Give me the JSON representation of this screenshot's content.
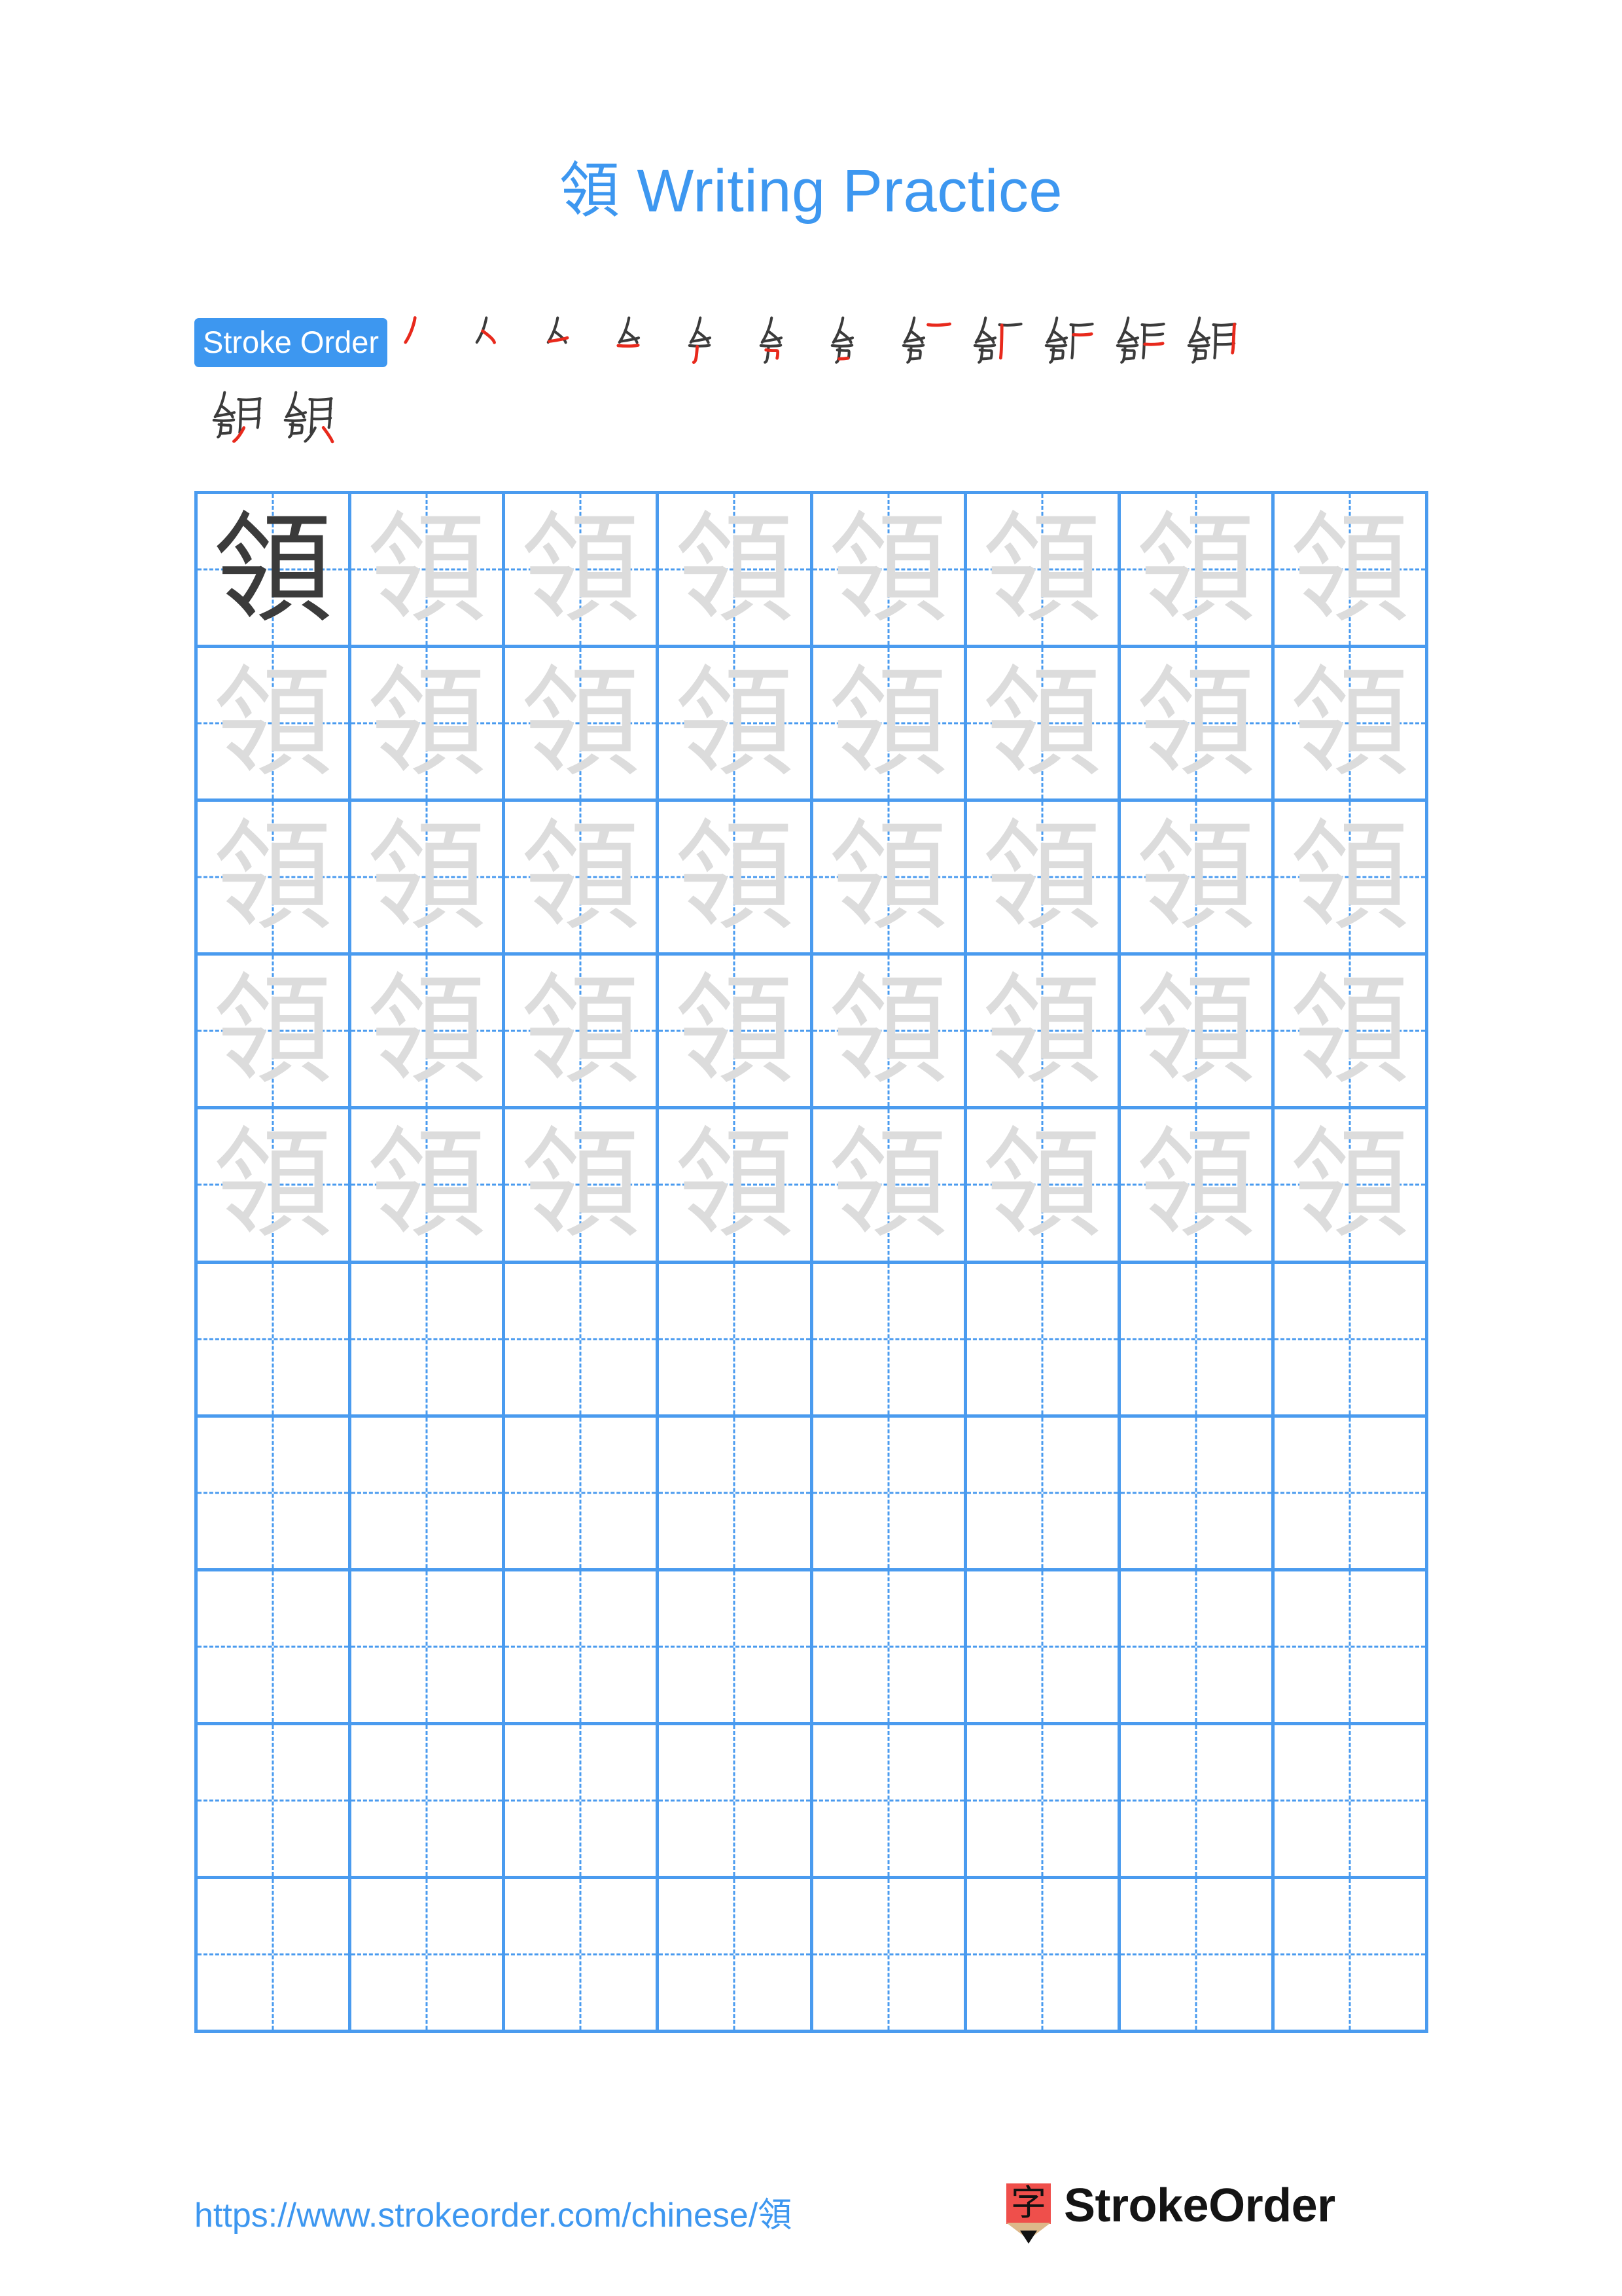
{
  "character": "領",
  "title": {
    "character": "領",
    "suffix": " Writing Practice",
    "full": "領 Writing Practice",
    "color": "#3d97f0"
  },
  "stroke_order": {
    "badge_label": "Stroke Order",
    "badge_bg": "#3d97f0",
    "badge_text_color": "#ffffff",
    "total_strokes": 14,
    "new_stroke_color": "#e8291c",
    "existing_stroke_color": "#3b3b3b",
    "row_1_count": 12,
    "row_2_count": 2,
    "steps": [
      {
        "index": 1,
        "strokes_shown": 1
      },
      {
        "index": 2,
        "strokes_shown": 2
      },
      {
        "index": 3,
        "strokes_shown": 3
      },
      {
        "index": 4,
        "strokes_shown": 4
      },
      {
        "index": 5,
        "strokes_shown": 5
      },
      {
        "index": 6,
        "strokes_shown": 6
      },
      {
        "index": 7,
        "strokes_shown": 7
      },
      {
        "index": 8,
        "strokes_shown": 8
      },
      {
        "index": 9,
        "strokes_shown": 9
      },
      {
        "index": 10,
        "strokes_shown": 10
      },
      {
        "index": 11,
        "strokes_shown": 11
      },
      {
        "index": 12,
        "strokes_shown": 12
      },
      {
        "index": 13,
        "strokes_shown": 13
      },
      {
        "index": 14,
        "strokes_shown": 14
      }
    ]
  },
  "practice_grid": {
    "columns": 8,
    "rows": 10,
    "grid_line_color": "#4a9bef",
    "guide_line_color": "#4a9bef",
    "model_char_color": "#3b3b3b",
    "trace_char_color": "#dcdcdc",
    "filled_rows": 5,
    "empty_rows": 5,
    "cells": [
      {
        "r": 1,
        "c": 1,
        "char": "領",
        "style": "dark"
      },
      {
        "r": 1,
        "c": 2,
        "char": "領",
        "style": "light"
      },
      {
        "r": 1,
        "c": 3,
        "char": "領",
        "style": "light"
      },
      {
        "r": 1,
        "c": 4,
        "char": "領",
        "style": "light"
      },
      {
        "r": 1,
        "c": 5,
        "char": "領",
        "style": "light"
      },
      {
        "r": 1,
        "c": 6,
        "char": "領",
        "style": "light"
      },
      {
        "r": 1,
        "c": 7,
        "char": "領",
        "style": "light"
      },
      {
        "r": 1,
        "c": 8,
        "char": "領",
        "style": "light"
      },
      {
        "r": 2,
        "c": 1,
        "char": "領",
        "style": "light"
      },
      {
        "r": 2,
        "c": 2,
        "char": "領",
        "style": "light"
      },
      {
        "r": 2,
        "c": 3,
        "char": "領",
        "style": "light"
      },
      {
        "r": 2,
        "c": 4,
        "char": "領",
        "style": "light"
      },
      {
        "r": 2,
        "c": 5,
        "char": "領",
        "style": "light"
      },
      {
        "r": 2,
        "c": 6,
        "char": "領",
        "style": "light"
      },
      {
        "r": 2,
        "c": 7,
        "char": "領",
        "style": "light"
      },
      {
        "r": 2,
        "c": 8,
        "char": "領",
        "style": "light"
      },
      {
        "r": 3,
        "c": 1,
        "char": "領",
        "style": "light"
      },
      {
        "r": 3,
        "c": 2,
        "char": "領",
        "style": "light"
      },
      {
        "r": 3,
        "c": 3,
        "char": "領",
        "style": "light"
      },
      {
        "r": 3,
        "c": 4,
        "char": "領",
        "style": "light"
      },
      {
        "r": 3,
        "c": 5,
        "char": "領",
        "style": "light"
      },
      {
        "r": 3,
        "c": 6,
        "char": "領",
        "style": "light"
      },
      {
        "r": 3,
        "c": 7,
        "char": "領",
        "style": "light"
      },
      {
        "r": 3,
        "c": 8,
        "char": "領",
        "style": "light"
      },
      {
        "r": 4,
        "c": 1,
        "char": "領",
        "style": "light"
      },
      {
        "r": 4,
        "c": 2,
        "char": "領",
        "style": "light"
      },
      {
        "r": 4,
        "c": 3,
        "char": "領",
        "style": "light"
      },
      {
        "r": 4,
        "c": 4,
        "char": "領",
        "style": "light"
      },
      {
        "r": 4,
        "c": 5,
        "char": "領",
        "style": "light"
      },
      {
        "r": 4,
        "c": 6,
        "char": "領",
        "style": "light"
      },
      {
        "r": 4,
        "c": 7,
        "char": "領",
        "style": "light"
      },
      {
        "r": 4,
        "c": 8,
        "char": "領",
        "style": "light"
      },
      {
        "r": 5,
        "c": 1,
        "char": "領",
        "style": "light"
      },
      {
        "r": 5,
        "c": 2,
        "char": "領",
        "style": "light"
      },
      {
        "r": 5,
        "c": 3,
        "char": "領",
        "style": "light"
      },
      {
        "r": 5,
        "c": 4,
        "char": "領",
        "style": "light"
      },
      {
        "r": 5,
        "c": 5,
        "char": "領",
        "style": "light"
      },
      {
        "r": 5,
        "c": 6,
        "char": "領",
        "style": "light"
      },
      {
        "r": 5,
        "c": 7,
        "char": "領",
        "style": "light"
      },
      {
        "r": 5,
        "c": 8,
        "char": "領",
        "style": "light"
      },
      {
        "r": 6,
        "c": 1,
        "char": "",
        "style": "empty"
      },
      {
        "r": 6,
        "c": 2,
        "char": "",
        "style": "empty"
      },
      {
        "r": 6,
        "c": 3,
        "char": "",
        "style": "empty"
      },
      {
        "r": 6,
        "c": 4,
        "char": "",
        "style": "empty"
      },
      {
        "r": 6,
        "c": 5,
        "char": "",
        "style": "empty"
      },
      {
        "r": 6,
        "c": 6,
        "char": "",
        "style": "empty"
      },
      {
        "r": 6,
        "c": 7,
        "char": "",
        "style": "empty"
      },
      {
        "r": 6,
        "c": 8,
        "char": "",
        "style": "empty"
      },
      {
        "r": 7,
        "c": 1,
        "char": "",
        "style": "empty"
      },
      {
        "r": 7,
        "c": 2,
        "char": "",
        "style": "empty"
      },
      {
        "r": 7,
        "c": 3,
        "char": "",
        "style": "empty"
      },
      {
        "r": 7,
        "c": 4,
        "char": "",
        "style": "empty"
      },
      {
        "r": 7,
        "c": 5,
        "char": "",
        "style": "empty"
      },
      {
        "r": 7,
        "c": 6,
        "char": "",
        "style": "empty"
      },
      {
        "r": 7,
        "c": 7,
        "char": "",
        "style": "empty"
      },
      {
        "r": 7,
        "c": 8,
        "char": "",
        "style": "empty"
      },
      {
        "r": 8,
        "c": 1,
        "char": "",
        "style": "empty"
      },
      {
        "r": 8,
        "c": 2,
        "char": "",
        "style": "empty"
      },
      {
        "r": 8,
        "c": 3,
        "char": "",
        "style": "empty"
      },
      {
        "r": 8,
        "c": 4,
        "char": "",
        "style": "empty"
      },
      {
        "r": 8,
        "c": 5,
        "char": "",
        "style": "empty"
      },
      {
        "r": 8,
        "c": 6,
        "char": "",
        "style": "empty"
      },
      {
        "r": 8,
        "c": 7,
        "char": "",
        "style": "empty"
      },
      {
        "r": 8,
        "c": 8,
        "char": "",
        "style": "empty"
      },
      {
        "r": 9,
        "c": 1,
        "char": "",
        "style": "empty"
      },
      {
        "r": 9,
        "c": 2,
        "char": "",
        "style": "empty"
      },
      {
        "r": 9,
        "c": 3,
        "char": "",
        "style": "empty"
      },
      {
        "r": 9,
        "c": 4,
        "char": "",
        "style": "empty"
      },
      {
        "r": 9,
        "c": 5,
        "char": "",
        "style": "empty"
      },
      {
        "r": 9,
        "c": 6,
        "char": "",
        "style": "empty"
      },
      {
        "r": 9,
        "c": 7,
        "char": "",
        "style": "empty"
      },
      {
        "r": 9,
        "c": 8,
        "char": "",
        "style": "empty"
      },
      {
        "r": 10,
        "c": 1,
        "char": "",
        "style": "empty"
      },
      {
        "r": 10,
        "c": 2,
        "char": "",
        "style": "empty"
      },
      {
        "r": 10,
        "c": 3,
        "char": "",
        "style": "empty"
      },
      {
        "r": 10,
        "c": 4,
        "char": "",
        "style": "empty"
      },
      {
        "r": 10,
        "c": 5,
        "char": "",
        "style": "empty"
      },
      {
        "r": 10,
        "c": 6,
        "char": "",
        "style": "empty"
      },
      {
        "r": 10,
        "c": 7,
        "char": "",
        "style": "empty"
      },
      {
        "r": 10,
        "c": 8,
        "char": "",
        "style": "empty"
      }
    ]
  },
  "footer": {
    "url": "https://www.strokeorder.com/chinese/領",
    "url_color": "#3d97f0",
    "brand_name": "StrokeOrder",
    "brand_glyph": "字",
    "pencil_body_color": "#ef4f4b",
    "pencil_wood_color": "#ddb88a",
    "pencil_tip_color": "#111111"
  }
}
